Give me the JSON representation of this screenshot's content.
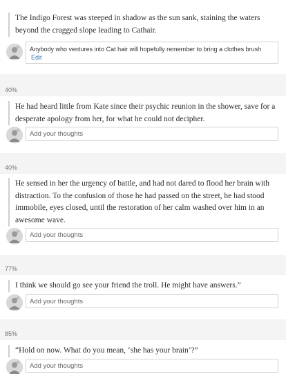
{
  "entries": [
    {
      "percent": "",
      "quote": "The Indigo Forest was steeped in shadow as the sun sank, staining the waters beyond the cragged slope leading to Cathair.",
      "comment": "Anybody who ventures into Cat hair will hopefully remember to bring a clothes brush",
      "edit_label": "Edit"
    },
    {
      "percent": "40%",
      "quote": "He had heard little from Kate since their psychic reunion in the shower, save for a desperate apology from her, for what he could not decipher.",
      "placeholder": "Add your thoughts"
    },
    {
      "percent": "40%",
      "quote": "He sensed in her the urgency of battle, and had not dared to flood her brain with distraction. To the confusion of those he had passed on the street, he had stood immobile, eyes closed, until the restoration of her calm washed over him in an awesome wave.",
      "placeholder": "Add your thoughts"
    },
    {
      "percent": "77%",
      "quote": "I think we should go see your friend the troll. He might have answers.”",
      "placeholder": "Add your thoughts"
    },
    {
      "percent": "85%",
      "quote": "“Hold on now. What do you mean, ‘she has your brain’?”",
      "placeholder": "Add your thoughts"
    }
  ]
}
